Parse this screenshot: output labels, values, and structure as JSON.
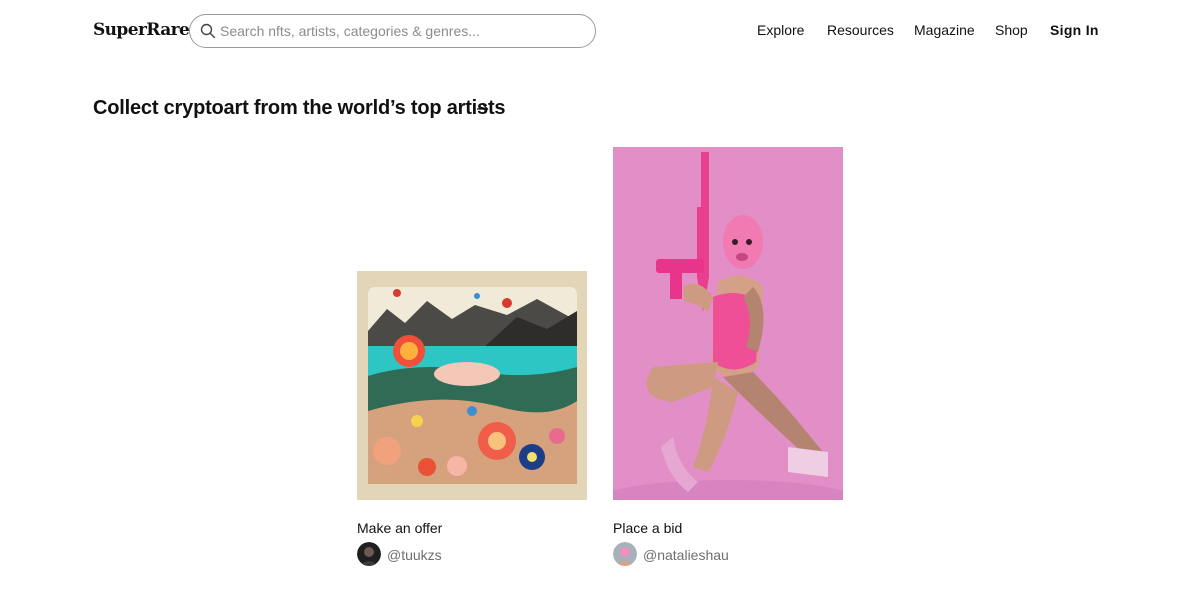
{
  "header": {
    "logo": "SuperRare",
    "search": {
      "placeholder": "Search nfts, artists, categories & genres..."
    },
    "nav": [
      {
        "label": "Explore"
      },
      {
        "label": "Resources"
      },
      {
        "label": "Magazine"
      },
      {
        "label": "Shop"
      },
      {
        "label": "Sign In"
      }
    ]
  },
  "section": {
    "title": "Collect cryptoart from the world’s top artists",
    "arrow_icon": "arrow-right-icon"
  },
  "cards": [
    {
      "status": "Make an offer",
      "artist": "@tuukzs",
      "artwork": "surreal-landscape-painting"
    },
    {
      "status": "Place a bid",
      "artist": "@natalieshau",
      "artwork": "pink-figure-photograph"
    }
  ],
  "colors": {
    "text": "#111111",
    "muted": "#6f6f6f",
    "border": "#9a9a9a",
    "pink_background": "#e28fc8"
  }
}
